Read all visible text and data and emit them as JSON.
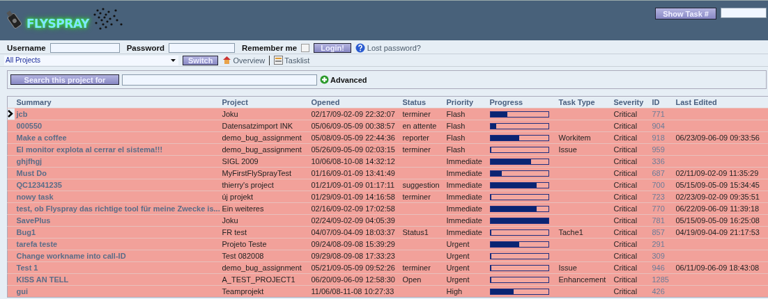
{
  "header": {
    "logo": "FLYSPRAY",
    "show_task_button": "Show Task #"
  },
  "login": {
    "username_label": "Username",
    "password_label": "Password",
    "remember_label": "Remember me",
    "remember_checked": false,
    "login_button": "Login!",
    "lost_password": "Lost password?"
  },
  "project_bar": {
    "project_select": "All Projects",
    "switch_button": "Switch",
    "links": [
      {
        "kind": "overview",
        "label": "Overview"
      },
      {
        "kind": "tasklist",
        "label": "Tasklist"
      }
    ]
  },
  "search": {
    "button": "Search this project for",
    "advanced": "Advanced"
  },
  "table": {
    "columns": [
      "Summary",
      "Project",
      "Opened",
      "Status",
      "Priority",
      "Progress",
      "Task Type",
      "Severity",
      "ID",
      "Last Edited"
    ],
    "rows": [
      {
        "selected": true,
        "summary": "jcb",
        "project": "Joku",
        "opened": "02/17/09-02-09 22:32:07",
        "status": "terminer",
        "priority": "Flash",
        "level": 0.3,
        "task_type": "",
        "severity": "Critical",
        "id": "771",
        "last_edited": ""
      },
      {
        "selected": false,
        "summary": "000550",
        "project": "Datensatzimport INK",
        "opened": "05/06/09-05-09 00:38:57",
        "status": "en attente",
        "priority": "Flash",
        "level": 0.1,
        "task_type": "",
        "severity": "Critical",
        "id": "904",
        "last_edited": ""
      },
      {
        "selected": false,
        "summary": "Make a coffee",
        "project": "demo_bug_assignment",
        "opened": "05/08/09-05-09 22:44:36",
        "status": "reporter",
        "priority": "Flash",
        "level": 0.5,
        "task_type": "Workitem",
        "severity": "Critical",
        "id": "918",
        "last_edited": "06/23/09-06-09 09:33:56"
      },
      {
        "selected": false,
        "summary": "El monitor explota al cerrar el sistema!!!",
        "project": "demo_bug_assignment",
        "opened": "05/26/09-05-09 02:03:15",
        "status": "terminer",
        "priority": "Flash",
        "level": 0,
        "task_type": "Issue",
        "severity": "Critical",
        "id": "959",
        "last_edited": ""
      },
      {
        "selected": false,
        "summary": "ghjfhgj",
        "project": "SIGL 2009",
        "opened": "10/06/08-10-08 14:32:12",
        "status": "",
        "priority": "Immediate",
        "level": 0.7,
        "task_type": "",
        "severity": "Critical",
        "id": "336",
        "last_edited": ""
      },
      {
        "selected": false,
        "summary": "Must Do",
        "project": "MyFirstFlySprayTest",
        "opened": "01/16/09-01-09 13:41:49",
        "status": "",
        "priority": "Immediate",
        "level": 0.2,
        "task_type": "",
        "severity": "Critical",
        "id": "687",
        "last_edited": "02/11/09-02-09 11:35:29"
      },
      {
        "selected": false,
        "summary": "QC12341235",
        "project": "thierry's project",
        "opened": "01/21/09-01-09 01:17:11",
        "status": "suggestion",
        "priority": "Immediate",
        "level": 0.8,
        "task_type": "",
        "severity": "Critical",
        "id": "700",
        "last_edited": "05/15/09-05-09 15:34:45"
      },
      {
        "selected": false,
        "summary": "nowy task",
        "project": "új projekt",
        "opened": "01/29/09-01-09 14:16:58",
        "status": "terminer",
        "priority": "Immediate",
        "level": 0,
        "task_type": "",
        "severity": "Critical",
        "id": "723",
        "last_edited": "02/23/09-02-09 09:35:51"
      },
      {
        "selected": false,
        "summary": "test, ob Flyspray das richtige tool für meine Zwecke is...",
        "project": "Ein weiteres",
        "opened": "02/16/09-02-09 17:02:58",
        "status": "",
        "priority": "Immediate",
        "level": 0.8,
        "task_type": "",
        "severity": "Critical",
        "id": "770",
        "last_edited": "06/22/09-06-09 11:39:18"
      },
      {
        "selected": false,
        "summary": "SavePlus",
        "project": "Joku",
        "opened": "02/24/09-02-09 04:05:39",
        "status": "",
        "priority": "Immediate",
        "level": 1,
        "task_type": "",
        "severity": "Critical",
        "id": "781",
        "last_edited": "05/15/09-05-09 16:25:08"
      },
      {
        "selected": false,
        "summary": "Bug1",
        "project": "FR test",
        "opened": "04/07/09-04-09 18:03:37",
        "status": "Status1",
        "priority": "Immediate",
        "level": 0,
        "task_type": "Tache1",
        "severity": "Critical",
        "id": "857",
        "last_edited": "04/19/09-04-09 21:17:53"
      },
      {
        "selected": false,
        "summary": "tarefa teste",
        "project": "Projeto Teste",
        "opened": "09/24/08-09-08 15:39:29",
        "status": "",
        "priority": "Urgent",
        "level": 0.5,
        "task_type": "",
        "severity": "Critical",
        "id": "291",
        "last_edited": ""
      },
      {
        "selected": false,
        "summary": "Change workname into call-ID",
        "project": "Test 082008",
        "opened": "09/29/08-09-08 17:33:23",
        "status": "",
        "priority": "Urgent",
        "level": 0,
        "task_type": "",
        "severity": "Critical",
        "id": "309",
        "last_edited": ""
      },
      {
        "selected": false,
        "summary": "Test 1",
        "project": "demo_bug_assignment",
        "opened": "05/21/09-05-09 09:52:26",
        "status": "terminer",
        "priority": "Urgent",
        "level": 0,
        "task_type": "Issue",
        "severity": "Critical",
        "id": "946",
        "last_edited": "06/11/09-06-09 18:43:08"
      },
      {
        "selected": false,
        "summary": "KISS AN TELL",
        "project": "A_TEST_PROJECT1",
        "opened": "06/20/09-06-09 12:58:30",
        "status": "Open",
        "priority": "Urgent",
        "level": 0,
        "task_type": "Enhancement",
        "severity": "Critical",
        "id": "1285",
        "last_edited": ""
      },
      {
        "selected": false,
        "summary": "gui",
        "project": "Teamprojekt",
        "opened": "11/06/08-11-08 10:27:33",
        "status": "",
        "priority": "High",
        "level": 0.4,
        "task_type": "",
        "severity": "Critical",
        "id": "426",
        "last_edited": ""
      }
    ]
  }
}
